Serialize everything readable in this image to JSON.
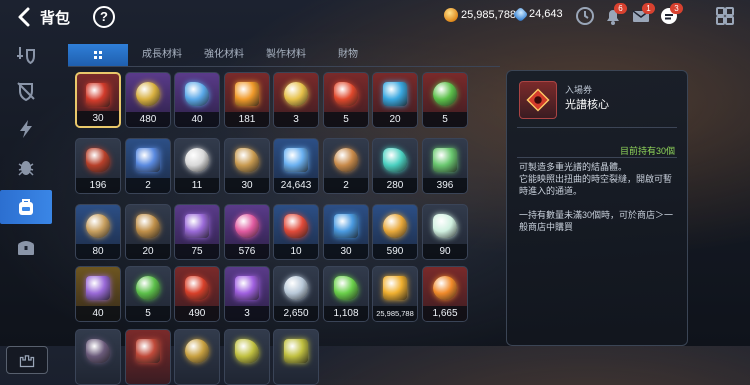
{
  "header": {
    "title": "背包",
    "help_label": "?",
    "gold": "25,985,788",
    "gems": "24,643",
    "badges": {
      "alarm": "6",
      "mail": "1",
      "chat": "3"
    },
    "icons": [
      "back-arrow-icon",
      "help-icon",
      "clock-icon",
      "alarm-bell-icon",
      "mail-icon",
      "chat-icon",
      "menu-grid-icon"
    ]
  },
  "sidebar": {
    "items": [
      {
        "icon": "sword-shield-icon"
      },
      {
        "icon": "shield-off-icon"
      },
      {
        "icon": "lightning-icon"
      },
      {
        "icon": "beetle-icon"
      },
      {
        "icon": "backpack-icon",
        "active": true
      },
      {
        "icon": "chest-icon"
      }
    ],
    "bottom_icon": "castle-icon"
  },
  "tabs": [
    {
      "label": "",
      "icon": "all-grid-icon",
      "active": true
    },
    {
      "label": "成長材料"
    },
    {
      "label": "強化材料"
    },
    {
      "label": "製作材料"
    },
    {
      "label": "財物"
    }
  ],
  "items": [
    {
      "count": "30",
      "rarity": "r",
      "sel": true,
      "icon": "red-core-icon",
      "color": "#d23b2b"
    },
    {
      "count": "480",
      "rarity": "p",
      "icon": "eye-emblem-icon",
      "color": "#d8b040"
    },
    {
      "count": "40",
      "rarity": "p",
      "icon": "blue-eye-emblem-icon",
      "color": "#5aa8e8"
    },
    {
      "count": "181",
      "rarity": "r",
      "icon": "flame-crystal-icon",
      "color": "#f09a2a"
    },
    {
      "count": "3",
      "rarity": "r",
      "icon": "golden-ticket-icon",
      "color": "#e6c14a"
    },
    {
      "count": "5",
      "rarity": "r",
      "icon": "fire-essence-icon",
      "color": "#e0482c"
    },
    {
      "count": "20",
      "rarity": "r",
      "icon": "water-essence-icon",
      "color": "#3aa8e0"
    },
    {
      "count": "5",
      "rarity": "r",
      "icon": "leaf-essence-icon",
      "color": "#5cc04a"
    },
    {
      "count": "196",
      "rarity": "n",
      "icon": "red-coin-icon",
      "color": "#b8402a"
    },
    {
      "count": "2",
      "rarity": "b",
      "icon": "blue-ticket-icon",
      "color": "#5a8ae0"
    },
    {
      "count": "11",
      "rarity": "n",
      "icon": "white-branch-icon",
      "color": "#d8d8d8"
    },
    {
      "count": "30",
      "rarity": "n",
      "icon": "bullet-icon",
      "color": "#c89a50"
    },
    {
      "count": "24,643",
      "rarity": "b",
      "icon": "blue-gem-icon",
      "color": "#6ab0f0"
    },
    {
      "count": "2",
      "rarity": "n",
      "icon": "torch-icon",
      "color": "#c88a4a"
    },
    {
      "count": "280",
      "rarity": "n",
      "icon": "teal-crystal-icon",
      "color": "#4ad0c0"
    },
    {
      "count": "396",
      "rarity": "n",
      "icon": "green-feather-icon",
      "color": "#6ac870"
    },
    {
      "count": "80",
      "rarity": "b",
      "icon": "compass-icon",
      "color": "#c8a060"
    },
    {
      "count": "20",
      "rarity": "n",
      "icon": "bronze-coin-icon",
      "color": "#c0904a"
    },
    {
      "count": "75",
      "rarity": "p",
      "icon": "skill-book-icon",
      "color": "#9a6ad8"
    },
    {
      "count": "576",
      "rarity": "p",
      "icon": "pink-crystal-pile-icon",
      "color": "#e05aa0"
    },
    {
      "count": "10",
      "rarity": "b",
      "icon": "red-fragment-icon",
      "color": "#e04a3a"
    },
    {
      "count": "30",
      "rarity": "b",
      "icon": "blue-fragment-icon",
      "color": "#4a9ae0"
    },
    {
      "count": "590",
      "rarity": "b",
      "icon": "star-badge-icon",
      "color": "#e8a83a"
    },
    {
      "count": "90",
      "rarity": "n",
      "icon": "white-star-icon",
      "color": "#d0f0e0"
    },
    {
      "count": "40",
      "rarity": "g",
      "icon": "purple-card-icon",
      "color": "#9a6ad8"
    },
    {
      "count": "5",
      "rarity": "n",
      "icon": "green-herb-icon",
      "color": "#5cc04a"
    },
    {
      "count": "490",
      "rarity": "r",
      "icon": "red-ring-icon",
      "color": "#d8402a"
    },
    {
      "count": "3",
      "rarity": "p",
      "icon": "purple-medal-icon",
      "color": "#a060e0"
    },
    {
      "count": "2,650",
      "rarity": "n",
      "icon": "silver-shard-icon",
      "color": "#b8c8d8"
    },
    {
      "count": "1,108",
      "rarity": "n",
      "icon": "green-heart-icon",
      "color": "#6ad04a"
    },
    {
      "count": "25,985,788",
      "rarity": "n",
      "small": true,
      "icon": "gold-coin-icon",
      "color": "#f0b030"
    },
    {
      "count": "1,665",
      "rarity": "r",
      "icon": "orange-emblem-icon",
      "color": "#f08a2a"
    },
    {
      "count": "",
      "rarity": "n",
      "icon": "partial-item-icon",
      "color": "#6a5a7a"
    },
    {
      "count": "",
      "rarity": "r",
      "icon": "partial-item-icon",
      "color": "#c04a3a"
    },
    {
      "count": "",
      "rarity": "n",
      "icon": "partial-item-icon",
      "color": "#c8a040"
    },
    {
      "count": "",
      "rarity": "n",
      "icon": "partial-item-icon",
      "color": "#c0c040"
    },
    {
      "count": "",
      "rarity": "n",
      "icon": "partial-item-icon",
      "color": "#c0c040"
    }
  ],
  "detail": {
    "category": "入場券",
    "name": "光譜核心",
    "owned": "目前持有30個",
    "description": "可製造多重光譜的結晶體。\n它能映照出扭曲的時空裂縫，開啟可暫時進入的通道。\n\n一持有數量未滿30個時，可於商店＞一般商店中購買"
  }
}
